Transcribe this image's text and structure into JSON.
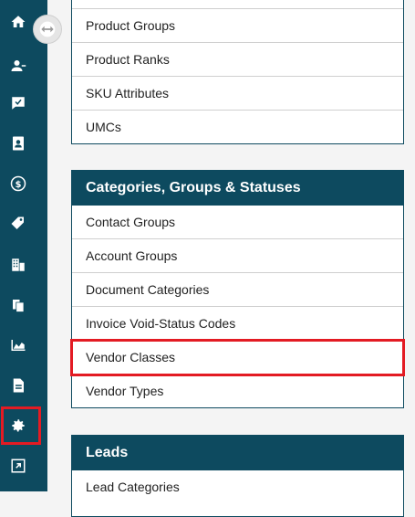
{
  "sidebar": {
    "icons": [
      "home-icon",
      "contacts-icon",
      "tasks-icon",
      "address-book-icon",
      "dollar-icon",
      "tags-icon",
      "buildings-icon",
      "documents-icon",
      "chart-icon",
      "file-icon",
      "gear-icon",
      "external-link-icon"
    ],
    "toggle_icon": "collapse-toggle-icon"
  },
  "cards": {
    "products": {
      "items": [
        "Product Groups",
        "Product Ranks",
        "SKU Attributes",
        "UMCs"
      ]
    },
    "categories": {
      "title": "Categories, Groups & Statuses",
      "items": [
        "Contact Groups",
        "Account Groups",
        "Document Categories",
        "Invoice Void-Status Codes",
        "Vendor Classes",
        "Vendor Types"
      ]
    },
    "leads": {
      "title": "Leads",
      "items": [
        "Lead Categories"
      ]
    }
  },
  "colors": {
    "primary": "#0d4a5f",
    "highlight": "#e31b23",
    "background": "#f4f4f4"
  }
}
